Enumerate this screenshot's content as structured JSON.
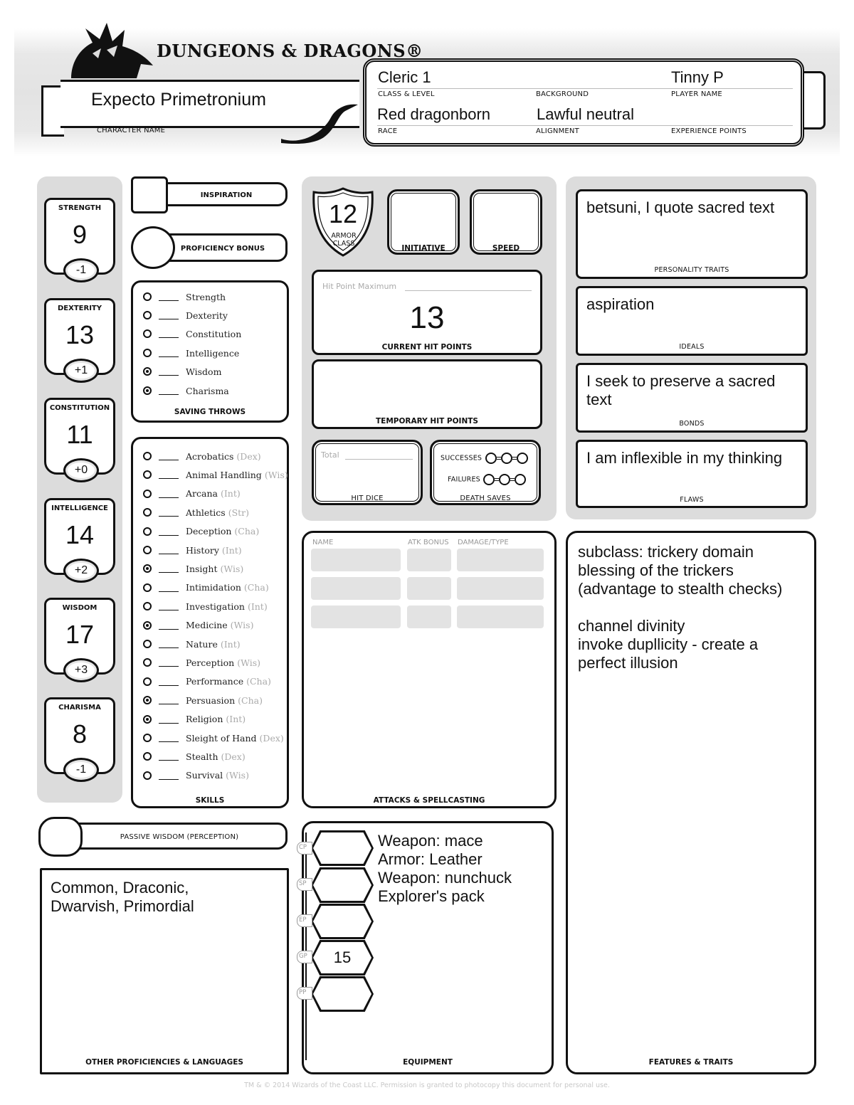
{
  "header": {
    "logo": "DUNGEONS & DRAGONS®",
    "character_name": "Expecto Primetronium",
    "character_name_label": "CHARACTER NAME",
    "fields": {
      "class_level": {
        "label": "CLASS & LEVEL",
        "value": "Cleric 1"
      },
      "background": {
        "label": "BACKGROUND",
        "value": ""
      },
      "player_name": {
        "label": "PLAYER NAME",
        "value": "Tinny P"
      },
      "race": {
        "label": "RACE",
        "value": "Red dragonborn"
      },
      "alignment": {
        "label": "ALIGNMENT",
        "value": "Lawful neutral"
      },
      "experience_points": {
        "label": "EXPERIENCE POINTS",
        "value": ""
      }
    }
  },
  "abilities": [
    {
      "name": "STRENGTH",
      "score": "9",
      "modifier": "-1"
    },
    {
      "name": "DEXTERITY",
      "score": "13",
      "modifier": "+1"
    },
    {
      "name": "CONSTITUTION",
      "score": "11",
      "modifier": "+0"
    },
    {
      "name": "INTELLIGENCE",
      "score": "14",
      "modifier": "+2"
    },
    {
      "name": "WISDOM",
      "score": "17",
      "modifier": "+3"
    },
    {
      "name": "CHARISMA",
      "score": "8",
      "modifier": "-1"
    }
  ],
  "inspiration": {
    "label": "INSPIRATION",
    "value": ""
  },
  "proficiency_bonus": {
    "label": "PROFICIENCY BONUS",
    "value": ""
  },
  "saving_throws": {
    "title": "SAVING THROWS",
    "items": [
      {
        "label": "Strength",
        "proficient": false,
        "value": ""
      },
      {
        "label": "Dexterity",
        "proficient": false,
        "value": ""
      },
      {
        "label": "Constitution",
        "proficient": false,
        "value": ""
      },
      {
        "label": "Intelligence",
        "proficient": false,
        "value": ""
      },
      {
        "label": "Wisdom",
        "proficient": true,
        "value": ""
      },
      {
        "label": "Charisma",
        "proficient": true,
        "value": ""
      }
    ]
  },
  "skills": {
    "title": "SKILLS",
    "items": [
      {
        "label": "Acrobatics",
        "attr": "(Dex)",
        "proficient": false
      },
      {
        "label": "Animal Handling",
        "attr": "(Wis)",
        "proficient": false
      },
      {
        "label": "Arcana",
        "attr": "(Int)",
        "proficient": false
      },
      {
        "label": "Athletics",
        "attr": "(Str)",
        "proficient": false
      },
      {
        "label": "Deception",
        "attr": "(Cha)",
        "proficient": false
      },
      {
        "label": "History",
        "attr": "(Int)",
        "proficient": false
      },
      {
        "label": "Insight",
        "attr": "(Wis)",
        "proficient": true
      },
      {
        "label": "Intimidation",
        "attr": "(Cha)",
        "proficient": false
      },
      {
        "label": "Investigation",
        "attr": "(Int)",
        "proficient": false
      },
      {
        "label": "Medicine",
        "attr": "(Wis)",
        "proficient": true
      },
      {
        "label": "Nature",
        "attr": "(Int)",
        "proficient": false
      },
      {
        "label": "Perception",
        "attr": "(Wis)",
        "proficient": false
      },
      {
        "label": "Performance",
        "attr": "(Cha)",
        "proficient": false
      },
      {
        "label": "Persuasion",
        "attr": "(Cha)",
        "proficient": true
      },
      {
        "label": "Religion",
        "attr": "(Int)",
        "proficient": true
      },
      {
        "label": "Sleight of Hand",
        "attr": "(Dex)",
        "proficient": false
      },
      {
        "label": "Stealth",
        "attr": "(Dex)",
        "proficient": false
      },
      {
        "label": "Survival",
        "attr": "(Wis)",
        "proficient": false
      }
    ]
  },
  "passive_wisdom": {
    "label": "PASSIVE WISDOM (PERCEPTION)",
    "value": ""
  },
  "other_proficiencies": {
    "label": "OTHER PROFICIENCIES & LANGUAGES",
    "text": "Common, Draconic,\nDwarvish, Primordial"
  },
  "combat": {
    "armor_class": {
      "value": "12",
      "label": "ARMOR CLASS"
    },
    "initiative": {
      "value": "",
      "label": "INITIATIVE"
    },
    "speed": {
      "value": "",
      "label": "SPEED"
    },
    "hit_point_maximum_label": "Hit Point Maximum",
    "current_hit_points": {
      "value": "13",
      "label": "CURRENT HIT POINTS"
    },
    "temporary_hit_points": {
      "value": "",
      "label": "TEMPORARY HIT POINTS"
    },
    "hit_dice": {
      "total_label": "Total",
      "label": "HIT DICE"
    },
    "death_saves": {
      "label": "DEATH SAVES",
      "successes_label": "SUCCESSES",
      "failures_label": "FAILURES",
      "successes": 0,
      "failures": 0
    }
  },
  "attacks": {
    "label": "ATTACKS & SPELLCASTING",
    "columns": [
      "NAME",
      "ATK BONUS",
      "DAMAGE/TYPE"
    ],
    "rows": [
      [
        "",
        "",
        ""
      ],
      [
        "",
        "",
        ""
      ],
      [
        "",
        "",
        ""
      ]
    ]
  },
  "equipment": {
    "label": "EQUIPMENT",
    "coins": [
      {
        "label": "CP",
        "value": ""
      },
      {
        "label": "SP",
        "value": ""
      },
      {
        "label": "EP",
        "value": ""
      },
      {
        "label": "GP",
        "value": "15"
      },
      {
        "label": "PP",
        "value": ""
      }
    ],
    "text": "Weapon: mace\nArmor: Leather\nWeapon: nunchuck\nExplorer's pack"
  },
  "personality": {
    "traits": {
      "label": "PERSONALITY TRAITS",
      "text": "betsuni, I quote sacred text"
    },
    "ideals": {
      "label": "IDEALS",
      "text": "aspiration"
    },
    "bonds": {
      "label": "BONDS",
      "text": "I seek to preserve a sacred\ntext"
    },
    "flaws": {
      "label": "FLAWS",
      "text": "I am inflexible in my thinking"
    }
  },
  "features": {
    "label": "FEATURES & TRAITS",
    "text": "subclass: trickery domain\nblessing of the trickers\n(advantage to stealth checks)\n\nchannel divinity\ninvoke dupllicity - create a\nperfect illusion"
  },
  "footer": "TM & © 2014 Wizards of the Coast LLC. Permission is granted to photocopy this document for personal use."
}
